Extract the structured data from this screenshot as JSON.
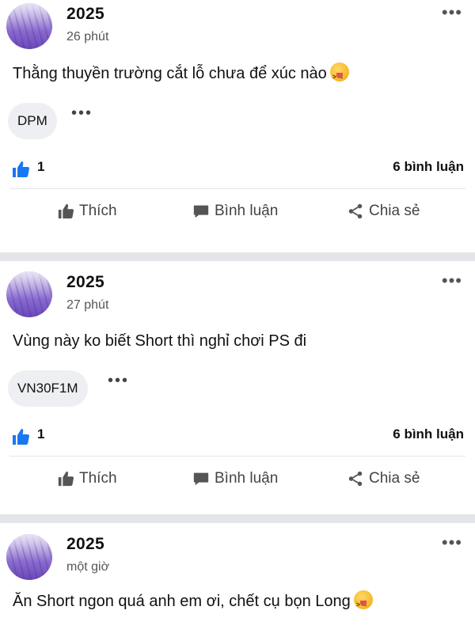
{
  "posts": [
    {
      "author": "2025",
      "time": "26 phút",
      "text": "Thằng thuyền trường cắt lỗ chưa để xúc nào",
      "has_emoji": true,
      "tag": "DPM",
      "likes": "1",
      "comments": "6 bình luận"
    },
    {
      "author": "2025",
      "time": "27 phút",
      "text": "Vùng này ko biết Short thì nghỉ chơi PS đi",
      "has_emoji": false,
      "tag": "VN30F1M",
      "likes": "1",
      "comments": "6 bình luận"
    },
    {
      "author": "2025",
      "time": "một giờ",
      "text": "Ăn Short ngon quá anh em ơi, chết cụ bọn Long",
      "has_emoji": true
    }
  ],
  "actions": {
    "like": "Thích",
    "comment": "Bình luận",
    "share": "Chia sẻ"
  },
  "icons": {
    "more": "more-horizontal-icon",
    "like": "thumbs-up-icon",
    "comment": "speech-bubble-icon",
    "share": "share-icon",
    "emoji": "squinting-tongue-emoji-icon"
  },
  "colors": {
    "like_blue": "#1877f2",
    "separator": "#e4e5e8",
    "tag_bg": "#eeeff2"
  }
}
